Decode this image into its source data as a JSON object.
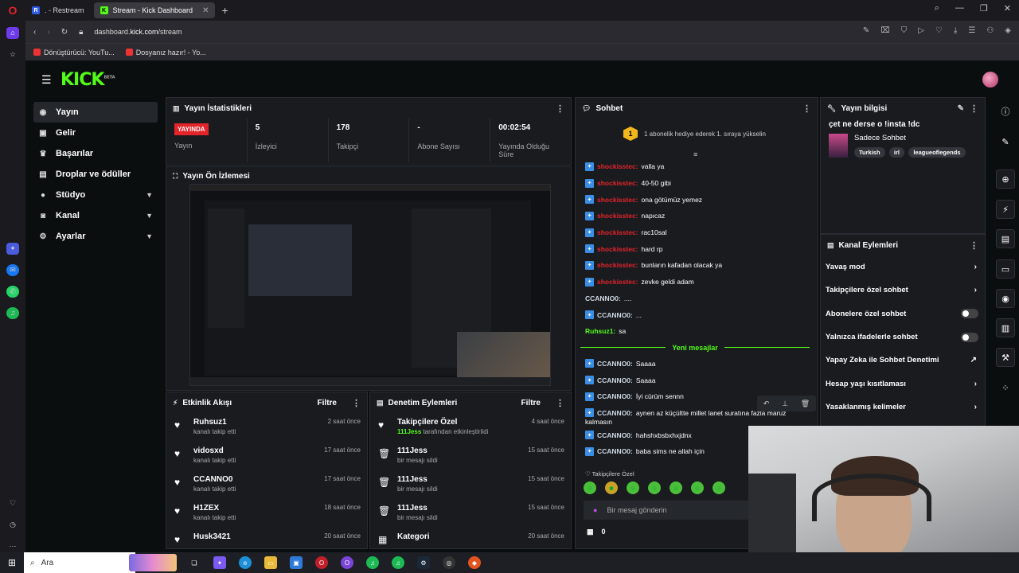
{
  "browser": {
    "tabs": [
      {
        "label": ". - Restream",
        "active": false
      },
      {
        "label": "Stream - Kick Dashboard",
        "active": true
      }
    ],
    "url_prefix": "dashboard.",
    "url_domain": "kick.com",
    "url_path": "/stream",
    "bookmarks": [
      "Dönüştürücü: YouTu...",
      "Dosyanız hazır! - Yo..."
    ]
  },
  "kick": {
    "logo": "KICK",
    "logo_badge": "BETA",
    "nav": [
      {
        "label": "Yayın",
        "icon": "broadcast-icon",
        "chevron": false
      },
      {
        "label": "Gelir",
        "icon": "wallet-icon",
        "chevron": false
      },
      {
        "label": "Başarılar",
        "icon": "trophy-icon",
        "chevron": false
      },
      {
        "label": "Droplar ve ödüller",
        "icon": "gift-icon",
        "chevron": false
      },
      {
        "label": "Stüdyo",
        "icon": "studio-icon",
        "chevron": true
      },
      {
        "label": "Kanal",
        "icon": "user-icon",
        "chevron": true
      },
      {
        "label": "Ayarlar",
        "icon": "gear-icon",
        "chevron": true
      }
    ]
  },
  "stats": {
    "title": "Yayın İstatistikleri",
    "live_label": "YAYINDA",
    "items": [
      {
        "value": "",
        "label": "Yayın"
      },
      {
        "value": "5",
        "label": "İzleyici"
      },
      {
        "value": "178",
        "label": "Takipçi"
      },
      {
        "value": "-",
        "label": "Abone Sayısı"
      },
      {
        "value": "00:02:54",
        "label": "Yayında Olduğu Süre"
      }
    ]
  },
  "preview": {
    "title": "Yayın Ön İzlemesi"
  },
  "activity": {
    "title": "Etkinlik Akışı",
    "filter": "Filtre",
    "items": [
      {
        "name": "Ruhsuz1",
        "sub": "kanalı takip etti",
        "time": "2 saat önce"
      },
      {
        "name": "vidosxd",
        "sub": "kanalı takip etti",
        "time": "17 saat önce"
      },
      {
        "name": "CCANNO0",
        "sub": "kanalı takip etti",
        "time": "17 saat önce"
      },
      {
        "name": "H1ZEX",
        "sub": "kanalı takip etti",
        "time": "18 saat önce"
      },
      {
        "name": "Husk3421",
        "sub": "",
        "time": "20 saat önce"
      }
    ]
  },
  "moderation": {
    "title": "Denetim Eylemleri",
    "filter": "Filtre",
    "items": [
      {
        "name": "Takipçilere Özel",
        "sub_user": "111Jess",
        "sub": " tarafından etkinleştirildi",
        "time": "4 saat önce",
        "icon": "heart-icon"
      },
      {
        "name": "111Jess",
        "sub_user": "",
        "sub": "bir mesajı sildi",
        "time": "15 saat önce",
        "icon": "trash-icon"
      },
      {
        "name": "111Jess",
        "sub_user": "",
        "sub": "bir mesajı sildi",
        "time": "15 saat önce",
        "icon": "trash-icon"
      },
      {
        "name": "111Jess",
        "sub_user": "",
        "sub": "bir mesajı sildi",
        "time": "15 saat önce",
        "icon": "trash-icon"
      },
      {
        "name": "Kategori",
        "sub_user": "",
        "sub": "",
        "time": "20 saat önce",
        "icon": "category-icon"
      }
    ]
  },
  "chat": {
    "title": "Sohbet",
    "notice": "1 abonelik hediye ederek 1. sıraya yükselin",
    "notice_rank": "1",
    "messages": [
      {
        "user": "shockisstec",
        "text": "valla ya",
        "color": "red",
        "badge": true
      },
      {
        "user": "shockisstec",
        "text": "40-50 gibi",
        "color": "red",
        "badge": true
      },
      {
        "user": "shockisstec",
        "text": "ona götümüz yemez",
        "color": "red",
        "badge": true
      },
      {
        "user": "shockisstec",
        "text": "napıcaz",
        "color": "red",
        "badge": true
      },
      {
        "user": "shockisstec",
        "text": "rac10sal",
        "color": "red",
        "badge": true
      },
      {
        "user": "shockisstec",
        "text": "hard rp",
        "color": "red",
        "badge": true
      },
      {
        "user": "shockisstec",
        "text": "bunların kafadan olacak ya",
        "color": "red",
        "badge": true
      },
      {
        "user": "shockisstec",
        "text": "zevke geldi adam",
        "color": "red",
        "badge": true
      },
      {
        "user": "CCANNO0",
        "text": "....",
        "color": "wh",
        "badge": false
      },
      {
        "user": "CCANNO0",
        "text": "...",
        "color": "wh",
        "badge": true
      },
      {
        "user": "Ruhsuz1",
        "text": "sa",
        "color": "gr",
        "badge": false
      }
    ],
    "new_messages_label": "Yeni mesajlar",
    "new_messages": [
      {
        "user": "CCANNO0",
        "text": "Saaaa"
      },
      {
        "user": "CCANNO0",
        "text": "Saaaa"
      },
      {
        "user": "CCANNO0",
        "text": "İyi cürüm sennn"
      },
      {
        "user": "CCANNO0",
        "text": "aynen az küçültte millet lanet suratına fazla maruz"
      },
      {
        "user": "",
        "text": "kalmasın"
      },
      {
        "user": "CCANNO0",
        "text": "hahshxbsbxhxjdnx"
      },
      {
        "user": "CCANNO0",
        "text": "baba sims ne allah için"
      }
    ],
    "followers_only": "Takipçilere Özel",
    "input_placeholder": "Bir mesaj gönderin",
    "footer_count": "0"
  },
  "stream_info": {
    "title": "Yayın bilgisi",
    "stream_title": "çet ne derse o !insta !dc",
    "category": "Sadece Sohbet",
    "tags": [
      "Turkish",
      "irl",
      "leagueoflegends"
    ]
  },
  "channel_actions": {
    "title": "Kanal Eylemleri",
    "items": [
      {
        "label": "Yavaş mod",
        "control": "arrow"
      },
      {
        "label": "Takipçilere özel sohbet",
        "control": "arrow"
      },
      {
        "label": "Abonelere özel sohbet",
        "control": "toggle"
      },
      {
        "label": "Yalnızca ifadelerle sohbet",
        "control": "toggle"
      },
      {
        "label": "Yapay Zeka ile Sohbet Denetimi",
        "control": "external"
      },
      {
        "label": "Hesap yaşı kısıtlaması",
        "control": "arrow"
      },
      {
        "label": "Yasaklanmış kelimeler",
        "control": "arrow"
      }
    ]
  },
  "taskbar": {
    "search_placeholder": "Ara"
  }
}
